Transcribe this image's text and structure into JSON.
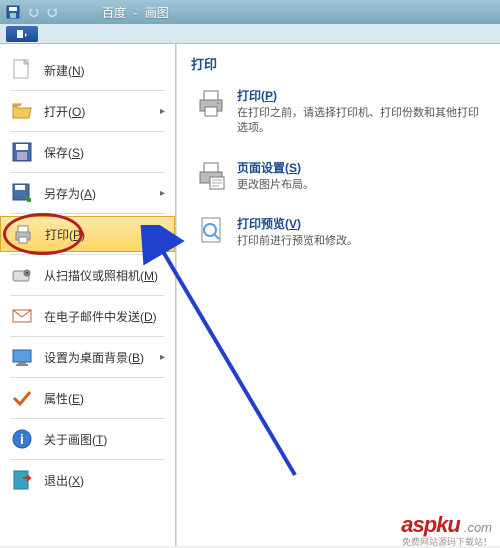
{
  "titlebar": {
    "doc": "百度",
    "app": "画图"
  },
  "menu": {
    "new": "新建(N)",
    "open": "打开(O)",
    "save": "保存(S)",
    "saveas": "另存为(A)",
    "print": "打印(P)",
    "scan": "从扫描仪或照相机(M)",
    "email": "在电子邮件中发送(D)",
    "wallpaper": "设置为桌面背景(B)",
    "props": "属性(E)",
    "about": "关于画图(T)",
    "exit": "退出(X)"
  },
  "submenu": {
    "title": "打印",
    "print": {
      "name": "打印(P)",
      "desc": "在打印之前，请选择打印机、打印份数和其他打印选项。"
    },
    "page": {
      "name": "页面设置(S)",
      "desc": "更改图片布局。"
    },
    "preview": {
      "name": "打印预览(V)",
      "desc": "打印前进行预览和修改。"
    }
  },
  "watermark": {
    "domain": "aspku",
    "suffix": ".com",
    "tag": "免费网站源码下载站！"
  }
}
